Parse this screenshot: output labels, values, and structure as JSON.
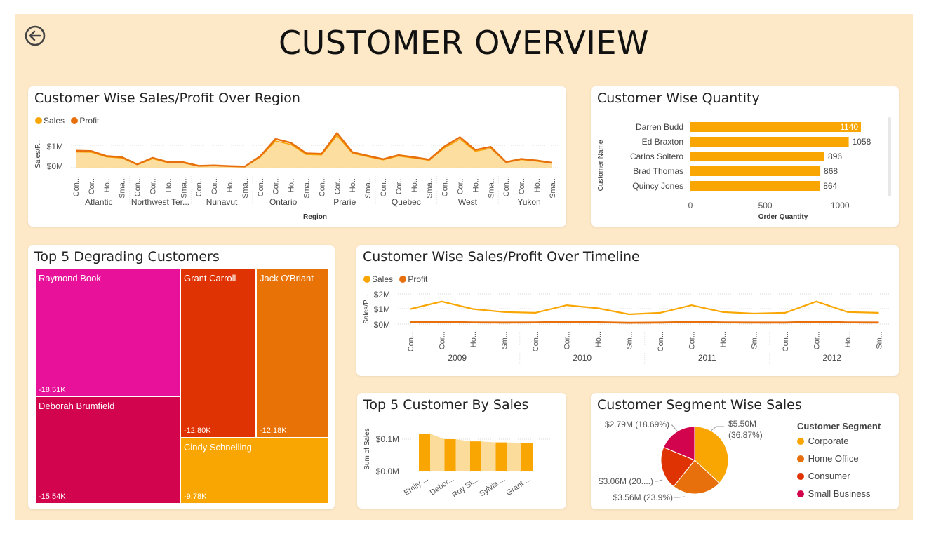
{
  "page_title": "CUSTOMER OVERVIEW",
  "icons": {
    "back": "back-arrow-icon"
  },
  "colors": {
    "background": "#fde9c7",
    "sales": "#f9a602",
    "profit": "#e7700d",
    "sales_fill": "#fcd68a"
  },
  "region_chart": {
    "title": "Customer Wise Sales/Profit Over Region",
    "legend": [
      {
        "label": "Sales",
        "color": "#f9a602"
      },
      {
        "label": "Profit",
        "color": "#e7700d"
      }
    ],
    "ylabel": "Sales/P...",
    "xlabel": "Region",
    "y_ticks": [
      "$1M",
      "$0M"
    ],
    "segment_ticks": [
      "Con...",
      "Cor...",
      "Ho...",
      "Sma..."
    ],
    "regions": [
      "Atlantic",
      "Northwest Ter...",
      "Nunavut",
      "Ontario",
      "Prarie",
      "Quebec",
      "West",
      "Yukon"
    ]
  },
  "quantity_chart": {
    "title": "Customer Wise Quantity",
    "ylabel": "Customer Name",
    "xlabel": "Order Quantity",
    "x_ticks": [
      "0",
      "500",
      "1000"
    ]
  },
  "treemap": {
    "title": "Top 5 Degrading Customers",
    "tiles": [
      {
        "name": "Raymond Book",
        "value": "-18.51K",
        "color": "#e8119a"
      },
      {
        "name": "Deborah Brumfield",
        "value": "-15.54K",
        "color": "#d2044d"
      },
      {
        "name": "Grant Carroll",
        "value": "-12.80K",
        "color": "#e03303"
      },
      {
        "name": "Jack O'Briant",
        "value": "-12.18K",
        "color": "#e87205"
      },
      {
        "name": "Cindy Schnelling",
        "value": "-9.78K",
        "color": "#f9a602"
      }
    ]
  },
  "timeline_chart": {
    "title": "Customer Wise Sales/Profit Over Timeline",
    "legend": [
      {
        "label": "Sales",
        "color": "#f9a602"
      },
      {
        "label": "Profit",
        "color": "#e7700d"
      }
    ],
    "ylabel": "Sales/P...",
    "y_ticks": [
      "$2M",
      "$1M",
      "$0M"
    ],
    "segment_ticks": [
      "Con...",
      "Cor...",
      "Ho...",
      "Sm..."
    ],
    "years": [
      "2009",
      "2010",
      "2011",
      "2012"
    ]
  },
  "top5_sales_chart": {
    "title": "Top 5 Customer By Sales",
    "ylabel": "Sum of Sales",
    "y_ticks": [
      "$0.1M",
      "$0.0M"
    ],
    "x_ticks": [
      "Emily ...",
      "Debor...",
      "Roy Sk...",
      "Sylvia ...",
      "Grant ..."
    ]
  },
  "segment_chart": {
    "title": "Customer Segment Wise Sales",
    "legend_title": "Customer Segment",
    "slice_labels": [
      "$5.50M",
      "(36.87%)",
      "$3.56M (23.9%)",
      "$3.06M (20....)",
      "$2.79M (18.69%)"
    ]
  },
  "chart_data": [
    {
      "type": "area",
      "title": "Customer Wise Sales/Profit Over Region",
      "xlabel": "Region",
      "ylabel": "Sales/P...",
      "ylim": [
        0,
        1500000
      ],
      "categories": [
        "Con...",
        "Cor...",
        "Ho...",
        "Sma...",
        "Con...",
        "Cor...",
        "Ho...",
        "Sma...",
        "Con...",
        "Cor...",
        "Ho...",
        "Sma...",
        "Con...",
        "Cor...",
        "Ho...",
        "Sma...",
        "Con...",
        "Cor...",
        "Ho...",
        "Sma...",
        "Con...",
        "Cor...",
        "Ho...",
        "Sma...",
        "Con...",
        "Cor...",
        "Ho...",
        "Sma...",
        "Con...",
        "Cor...",
        "Ho...",
        "Sma..."
      ],
      "groups": [
        "Atlantic",
        "Northwest Ter...",
        "Nunavut",
        "Ontario",
        "Prarie",
        "Quebec",
        "West",
        "Yukon"
      ],
      "series": [
        {
          "name": "Sales",
          "values": [
            700000,
            690000,
            480000,
            430000,
            130000,
            400000,
            220000,
            210000,
            70000,
            90000,
            60000,
            40000,
            470000,
            1190000,
            1030000,
            590000,
            570000,
            1430000,
            640000,
            490000,
            350000,
            520000,
            430000,
            330000,
            880000,
            1270000,
            730000,
            860000,
            230000,
            360000,
            290000,
            200000
          ]
        },
        {
          "name": "Profit",
          "values": [
            760000,
            740000,
            520000,
            470000,
            150000,
            440000,
            250000,
            240000,
            80000,
            100000,
            70000,
            50000,
            510000,
            1280000,
            1110000,
            640000,
            620000,
            1540000,
            690000,
            530000,
            380000,
            560000,
            470000,
            360000,
            950000,
            1360000,
            790000,
            930000,
            250000,
            390000,
            320000,
            220000
          ]
        }
      ],
      "legend": "top-left"
    },
    {
      "type": "bar",
      "title": "Customer Wise Quantity",
      "orientation": "horizontal",
      "xlabel": "Order Quantity",
      "ylabel": "Customer Name",
      "categories": [
        "Darren Budd",
        "Ed Braxton",
        "Carlos Soltero",
        "Brad Thomas",
        "Quincy Jones"
      ],
      "values": [
        1140,
        1058,
        896,
        868,
        864
      ],
      "xlim": [
        0,
        1250
      ]
    },
    {
      "type": "treemap",
      "title": "Top 5 Degrading Customers",
      "categories": [
        "Raymond Book",
        "Deborah Brumfield",
        "Grant Carroll",
        "Jack O'Briant",
        "Cindy Schnelling"
      ],
      "values": [
        -18510,
        -15540,
        -12800,
        -12180,
        -9780
      ]
    },
    {
      "type": "line",
      "title": "Customer Wise Sales/Profit Over Timeline",
      "ylabel": "Sales/P...",
      "ylim": [
        0,
        2000000
      ],
      "categories": [
        "Con...",
        "Cor...",
        "Ho...",
        "Sm...",
        "Con...",
        "Cor...",
        "Ho...",
        "Sm...",
        "Con...",
        "Cor...",
        "Ho...",
        "Sm...",
        "Con...",
        "Cor...",
        "Ho...",
        "Sm..."
      ],
      "groups": [
        "2009",
        "2010",
        "2011",
        "2012"
      ],
      "series": [
        {
          "name": "Sales",
          "values": [
            1000000,
            1500000,
            1000000,
            800000,
            750000,
            1250000,
            1050000,
            650000,
            750000,
            1250000,
            800000,
            700000,
            750000,
            1500000,
            800000,
            750000
          ]
        },
        {
          "name": "Profit",
          "values": [
            120000,
            150000,
            110000,
            100000,
            110000,
            160000,
            120000,
            90000,
            100000,
            140000,
            110000,
            100000,
            100000,
            160000,
            110000,
            100000
          ]
        }
      ],
      "legend": "top-left"
    },
    {
      "type": "bar",
      "title": "Top 5 Customer By Sales",
      "ylabel": "Sum of Sales",
      "categories": [
        "Emily ...",
        "Debor...",
        "Roy Sk...",
        "Sylvia ...",
        "Grant ..."
      ],
      "values": [
        0.117,
        0.1,
        0.093,
        0.09,
        0.089
      ],
      "unit": "$M",
      "ylim": [
        0,
        0.15
      ]
    },
    {
      "type": "pie",
      "title": "Customer Segment Wise Sales",
      "categories": [
        "Corporate",
        "Home Office",
        "Consumer",
        "Small Business"
      ],
      "values": [
        5.5,
        3.56,
        3.06,
        2.79
      ],
      "unit": "$M",
      "percentages": [
        36.87,
        23.9,
        20.5,
        18.69
      ],
      "colors": [
        "#f9a602",
        "#e7700d",
        "#e03303",
        "#d2044d"
      ],
      "legend": "right"
    }
  ]
}
